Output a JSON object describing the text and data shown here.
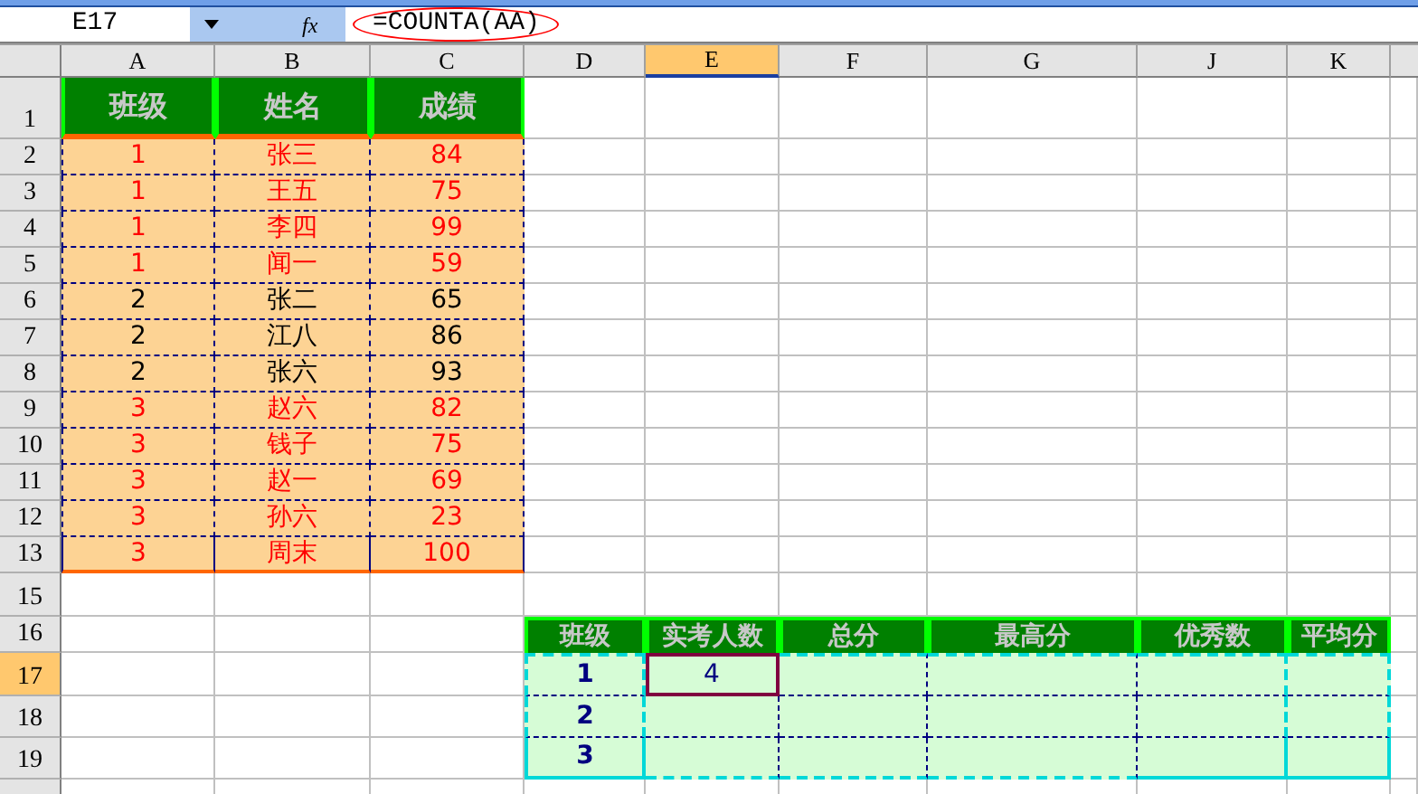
{
  "formula_bar": {
    "name_box": "E17",
    "fx": "fx",
    "formula": "=COUNTA(AA)"
  },
  "columns": [
    {
      "label": "A",
      "selected": false
    },
    {
      "label": "B",
      "selected": false
    },
    {
      "label": "C",
      "selected": false
    },
    {
      "label": "D",
      "selected": false
    },
    {
      "label": "E",
      "selected": true
    },
    {
      "label": "F",
      "selected": false
    },
    {
      "label": "G",
      "selected": false
    },
    {
      "label": "J",
      "selected": false
    },
    {
      "label": "K",
      "selected": false
    }
  ],
  "rows": [
    {
      "label": "1",
      "selected": false
    },
    {
      "label": "2",
      "selected": false
    },
    {
      "label": "3",
      "selected": false
    },
    {
      "label": "4",
      "selected": false
    },
    {
      "label": "5",
      "selected": false
    },
    {
      "label": "6",
      "selected": false
    },
    {
      "label": "7",
      "selected": false
    },
    {
      "label": "8",
      "selected": false
    },
    {
      "label": "9",
      "selected": false
    },
    {
      "label": "10",
      "selected": false
    },
    {
      "label": "11",
      "selected": false
    },
    {
      "label": "12",
      "selected": false
    },
    {
      "label": "13",
      "selected": false
    },
    {
      "label": "15",
      "selected": false
    },
    {
      "label": "16",
      "selected": false
    },
    {
      "label": "17",
      "selected": true
    },
    {
      "label": "18",
      "selected": false
    },
    {
      "label": "19",
      "selected": false
    }
  ],
  "students": {
    "headers": [
      "班级",
      "姓名",
      "成绩"
    ],
    "rows": [
      {
        "class": "1",
        "name": "张三",
        "score": "84",
        "color": "#ff0000"
      },
      {
        "class": "1",
        "name": "王五",
        "score": "75",
        "color": "#ff0000"
      },
      {
        "class": "1",
        "name": "李四",
        "score": "99",
        "color": "#ff0000"
      },
      {
        "class": "1",
        "name": "闻一",
        "score": "59",
        "color": "#ff0000"
      },
      {
        "class": "2",
        "name": "张二",
        "score": "65",
        "color": "#000000"
      },
      {
        "class": "2",
        "name": "江八",
        "score": "86",
        "color": "#000000"
      },
      {
        "class": "2",
        "name": "张六",
        "score": "93",
        "color": "#000000"
      },
      {
        "class": "3",
        "name": "赵六",
        "score": "82",
        "color": "#ff0000"
      },
      {
        "class": "3",
        "name": "钱子",
        "score": "75",
        "color": "#ff0000"
      },
      {
        "class": "3",
        "name": "赵一",
        "score": "69",
        "color": "#ff0000"
      },
      {
        "class": "3",
        "name": "孙六",
        "score": "23",
        "color": "#ff0000"
      },
      {
        "class": "3",
        "name": "周末",
        "score": "100",
        "color": "#ff0000"
      }
    ]
  },
  "summary": {
    "headers": [
      "班级",
      "实考人数",
      "总分",
      "最高分",
      "优秀数",
      "平均分"
    ],
    "rows": [
      {
        "class": "1",
        "count": "4",
        "selected": true
      },
      {
        "class": "2",
        "selected": false
      },
      {
        "class": "3",
        "selected": false
      }
    ]
  }
}
